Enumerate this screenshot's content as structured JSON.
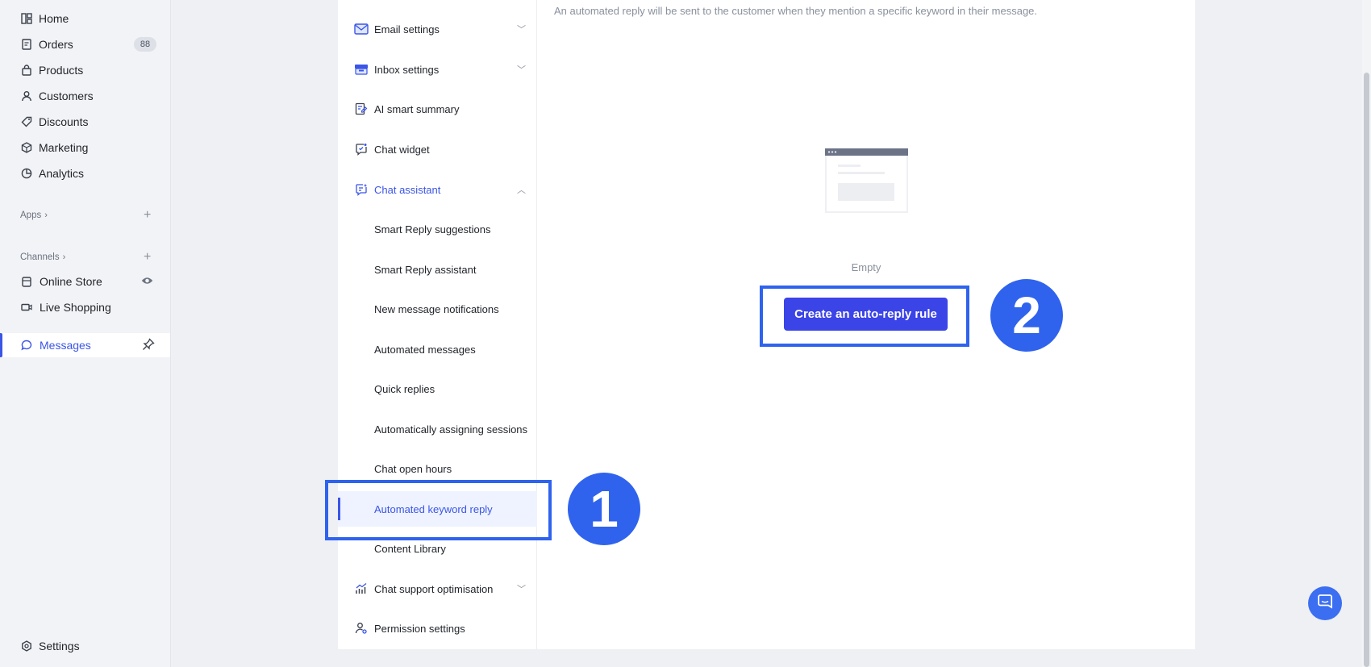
{
  "sidebar": {
    "items": [
      {
        "label": "Home",
        "icon": "home-icon"
      },
      {
        "label": "Orders",
        "icon": "orders-icon",
        "badge": "88"
      },
      {
        "label": "Products",
        "icon": "bag-icon"
      },
      {
        "label": "Customers",
        "icon": "user-icon"
      },
      {
        "label": "Discounts",
        "icon": "tag-icon"
      },
      {
        "label": "Marketing",
        "icon": "cube-icon"
      },
      {
        "label": "Analytics",
        "icon": "pie-icon"
      }
    ],
    "apps_label": "Apps",
    "channels_label": "Channels",
    "channels": [
      {
        "label": "Online Store",
        "icon": "store-icon"
      },
      {
        "label": "Live Shopping",
        "icon": "video-icon"
      }
    ],
    "messages_label": "Messages",
    "settings_label": "Settings"
  },
  "settings_menu": {
    "items": [
      {
        "label": "Email settings"
      },
      {
        "label": "Inbox settings"
      },
      {
        "label": "AI smart summary"
      },
      {
        "label": "Chat widget"
      },
      {
        "label": "Chat assistant"
      },
      {
        "label": "Smart Reply suggestions"
      },
      {
        "label": "Smart Reply assistant"
      },
      {
        "label": "New message notifications"
      },
      {
        "label": "Automated messages"
      },
      {
        "label": "Quick replies"
      },
      {
        "label": "Automatically assigning sessions"
      },
      {
        "label": "Chat open hours"
      },
      {
        "label": "Automated keyword reply"
      },
      {
        "label": "Content Library"
      },
      {
        "label": "Chat support optimisation"
      },
      {
        "label": "Permission settings"
      }
    ]
  },
  "main": {
    "description": "An automated reply will be sent to the customer when they mention a specific keyword in their message.",
    "empty_text": "Empty",
    "create_button": "Create an auto-reply rule"
  },
  "annotations": {
    "step1": "1",
    "step2": "2"
  },
  "colors": {
    "accent": "#3b55e6",
    "button": "#3b44e6",
    "annotation": "#2f63ee"
  }
}
